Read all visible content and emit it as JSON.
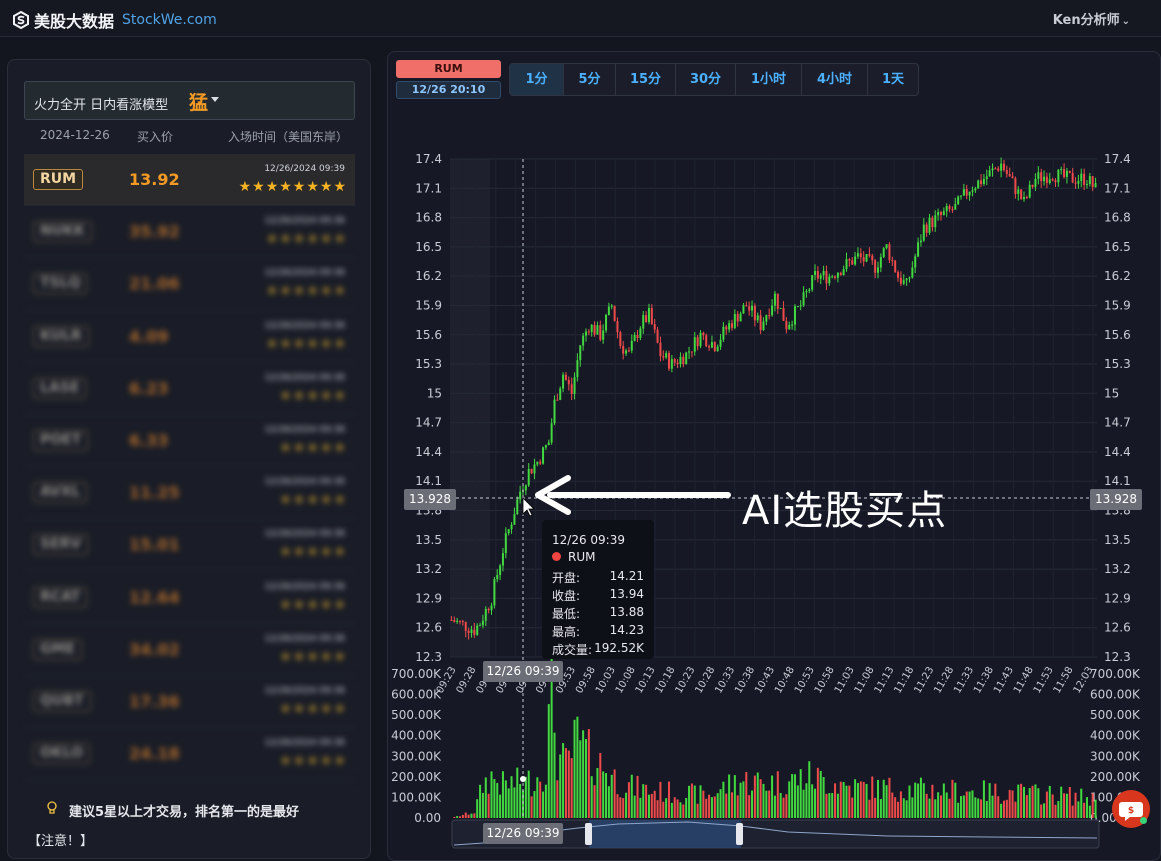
{
  "header": {
    "logo_cn": "美股大数据",
    "logo_en": "StockWe.com",
    "user_label": "Ken分析师"
  },
  "left_panel": {
    "model_name": "火力全开 日内看涨模型",
    "model_mode": "猛",
    "col_date": "2024-12-26",
    "col_price": "买入价",
    "col_time": "入场时间（美国东岸）",
    "rows": [
      {
        "ticker": "RUM",
        "price": "13.92",
        "time": "12/26/2024 09:39",
        "stars": 8
      },
      {
        "ticker": "NUKK",
        "price": "35.92",
        "time": "12/26/2024 09:36",
        "stars": 6
      },
      {
        "ticker": "TSLQ",
        "price": "21.06",
        "time": "12/26/2024 09:36",
        "stars": 6
      },
      {
        "ticker": "KULR",
        "price": "4.09",
        "time": "12/26/2024 09:36",
        "stars": 6
      },
      {
        "ticker": "LASE",
        "price": "6.23",
        "time": "12/26/2024 09:36",
        "stars": 5
      },
      {
        "ticker": "POET",
        "price": "6.33",
        "time": "12/26/2024 09:36",
        "stars": 5
      },
      {
        "ticker": "AVXL",
        "price": "11.25",
        "time": "12/26/2024 09:36",
        "stars": 5
      },
      {
        "ticker": "SERV",
        "price": "15.01",
        "time": "12/26/2024 09:36",
        "stars": 5
      },
      {
        "ticker": "RCAT",
        "price": "12.64",
        "time": "12/26/2024 09:36",
        "stars": 5
      },
      {
        "ticker": "GME",
        "price": "34.02",
        "time": "12/26/2024 09:36",
        "stars": 5
      },
      {
        "ticker": "QUBT",
        "price": "17.36",
        "time": "12/26/2024 09:36",
        "stars": 5
      },
      {
        "ticker": "OKLO",
        "price": "24.18",
        "time": "12/26/2024 09:36",
        "stars": 5
      }
    ],
    "tip": "建议5星以上才交易，排名第一的是最好",
    "note": "【注意！】"
  },
  "chart_header": {
    "symbol": "RUM",
    "datetime": "12/26 20:10",
    "periods": [
      "1分",
      "5分",
      "15分",
      "30分",
      "1小时",
      "4小时",
      "1天"
    ],
    "active_period": "1分"
  },
  "annotation": "AI选股买点",
  "crosshair": {
    "price_label": "13.928",
    "time_label": "12/26 09:39"
  },
  "tooltip": {
    "title": "12/26 09:39",
    "series": "RUM",
    "rows": [
      {
        "label": "开盘:",
        "value": "14.21"
      },
      {
        "label": "收盘:",
        "value": "13.94"
      },
      {
        "label": "最低:",
        "value": "13.88"
      },
      {
        "label": "最高:",
        "value": "14.23"
      },
      {
        "label": "成交量:",
        "value": "192.52K"
      }
    ]
  },
  "colors": {
    "up": "#41d93f",
    "down": "#ef4a4a",
    "accent": "#4ab0ff",
    "brand_orange": "#f39a25"
  },
  "chart_data": {
    "type": "candlestick",
    "price_axis_ticks": [
      "17.4",
      "17.1",
      "16.8",
      "16.5",
      "16.2",
      "15.9",
      "15.6",
      "15.3",
      "15",
      "14.7",
      "14.4",
      "14.1",
      "13.8",
      "13.5",
      "13.2",
      "12.9",
      "12.6",
      "12.3"
    ],
    "ylim": [
      12.3,
      17.4
    ],
    "volume_axis_ticks": [
      "700.00K",
      "600.00K",
      "500.00K",
      "400.00K",
      "300.00K",
      "200.00K",
      "100.00K",
      "0.00"
    ],
    "volume_ylim": [
      0,
      700000
    ],
    "time_ticks": [
      "09:23",
      "09:28",
      "09:33",
      "09:38",
      "09:43",
      "09:48",
      "09:53",
      "09:58",
      "10:03",
      "10:08",
      "10:13",
      "10:18",
      "10:23",
      "10:28",
      "10:33",
      "10:38",
      "10:43",
      "10:48",
      "10:53",
      "10:58",
      "11:03",
      "11:08",
      "11:13",
      "11:18",
      "11:23",
      "11:28",
      "11:33",
      "11:38",
      "11:43",
      "11:48",
      "11:53",
      "11:58",
      "12:03"
    ],
    "price_path": [
      [
        0,
        12.68
      ],
      [
        5,
        12.62
      ],
      [
        8,
        12.58
      ],
      [
        10,
        12.65
      ],
      [
        14,
        12.9
      ],
      [
        18,
        13.4
      ],
      [
        21,
        13.7
      ],
      [
        24,
        14.0
      ],
      [
        27,
        14.2
      ],
      [
        30,
        14.3
      ],
      [
        34,
        14.5
      ],
      [
        36,
        14.9
      ],
      [
        39,
        15.2
      ],
      [
        42,
        15.0
      ],
      [
        45,
        15.5
      ],
      [
        48,
        15.7
      ],
      [
        52,
        15.6
      ],
      [
        56,
        15.9
      ],
      [
        59,
        15.5
      ],
      [
        62,
        15.4
      ],
      [
        66,
        15.7
      ],
      [
        69,
        15.8
      ],
      [
        73,
        15.4
      ],
      [
        77,
        15.3
      ],
      [
        82,
        15.4
      ],
      [
        87,
        15.6
      ],
      [
        92,
        15.5
      ],
      [
        97,
        15.7
      ],
      [
        103,
        15.9
      ],
      [
        108,
        15.7
      ],
      [
        113,
        16.0
      ],
      [
        117,
        15.7
      ],
      [
        122,
        15.9
      ],
      [
        127,
        16.2
      ],
      [
        132,
        16.2
      ],
      [
        137,
        16.3
      ],
      [
        142,
        16.4
      ],
      [
        148,
        16.3
      ],
      [
        152,
        16.5
      ],
      [
        156,
        16.2
      ],
      [
        159,
        16.1
      ],
      [
        161,
        16.3
      ],
      [
        165,
        16.7
      ],
      [
        170,
        16.8
      ],
      [
        176,
        16.9
      ],
      [
        181,
        17.1
      ],
      [
        186,
        17.2
      ],
      [
        192,
        17.35
      ],
      [
        197,
        17.1
      ],
      [
        200,
        16.95
      ],
      [
        204,
        17.2
      ],
      [
        210,
        17.25
      ],
      [
        215,
        17.2
      ],
      [
        222,
        17.2
      ],
      [
        226,
        17.05
      ]
    ],
    "volume_profile": [
      [
        0,
        0
      ],
      [
        8,
        30000
      ],
      [
        11,
        160000
      ],
      [
        14,
        200000
      ],
      [
        18,
        160000
      ],
      [
        22,
        170000
      ],
      [
        26,
        170000
      ],
      [
        30,
        200000
      ],
      [
        33,
        250000
      ],
      [
        35,
        650000
      ],
      [
        37,
        300000
      ],
      [
        40,
        250000
      ],
      [
        44,
        380000
      ],
      [
        48,
        300000
      ],
      [
        53,
        250000
      ],
      [
        58,
        180000
      ],
      [
        63,
        150000
      ],
      [
        70,
        130000
      ],
      [
        80,
        120000
      ],
      [
        90,
        110000
      ],
      [
        100,
        180000
      ],
      [
        115,
        170000
      ],
      [
        125,
        200000
      ],
      [
        140,
        150000
      ],
      [
        160,
        140000
      ],
      [
        180,
        130000
      ],
      [
        200,
        120000
      ],
      [
        215,
        110000
      ],
      [
        226,
        90000
      ]
    ]
  }
}
